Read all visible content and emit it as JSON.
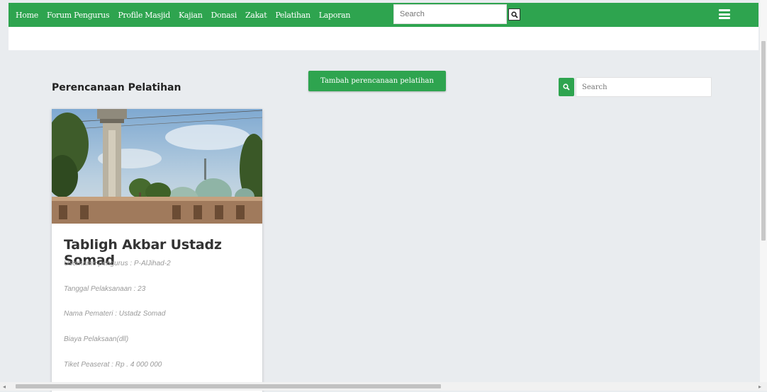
{
  "nav": {
    "links": [
      "Home",
      "Forum Pengurus",
      "Profile Masjid",
      "Kajian",
      "Donasi",
      "Zakat",
      "Pelatihan",
      "Laporan"
    ],
    "search_placeholder": "Search",
    "search_icon": "search-icon",
    "menu_icon": "hamburger-menu-icon",
    "bg_color": "#2ea44f"
  },
  "page": {
    "title": "Perencanaan Pelatihan",
    "add_button": "Tambah perencanaan pelatihan",
    "search_placeholder": "Search"
  },
  "card": {
    "title": "Tabligh Akbar Ustadz Somad",
    "fields": [
      "Username pengurus : P-AlJihad-2",
      "Tanggal Pelaksanaan : 23",
      "Nama Pemateri : Ustadz Somad",
      "Biaya Pelaksaan(dll)",
      "Tiket Peaserat : Rp . 4 000 000"
    ]
  }
}
